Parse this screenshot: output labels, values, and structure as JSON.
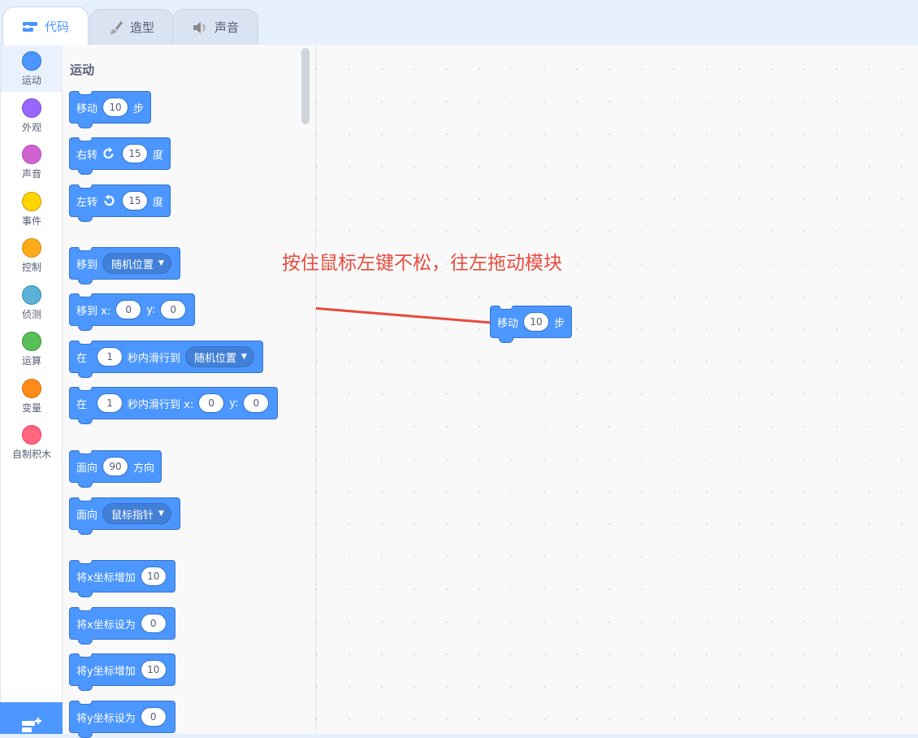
{
  "tabs": [
    {
      "label": "代码",
      "icon": "code-icon"
    },
    {
      "label": "造型",
      "icon": "paintbrush-icon"
    },
    {
      "label": "声音",
      "icon": "speaker-icon"
    }
  ],
  "categories": [
    {
      "label": "运动",
      "color": "#4c97ff"
    },
    {
      "label": "外观",
      "color": "#9966ff"
    },
    {
      "label": "声音",
      "color": "#cf63cf"
    },
    {
      "label": "事件",
      "color": "#ffd500"
    },
    {
      "label": "控制",
      "color": "#ffab19"
    },
    {
      "label": "侦测",
      "color": "#5cb1d6"
    },
    {
      "label": "运算",
      "color": "#59c059"
    },
    {
      "label": "变量",
      "color": "#ff8c1a"
    },
    {
      "label": "自制积木",
      "color": "#ff6680"
    }
  ],
  "palette": {
    "title": "运动",
    "move": {
      "a": "移动",
      "v": "10",
      "b": "步"
    },
    "turn_right": {
      "a": "右转",
      "v": "15",
      "b": "度"
    },
    "turn_left": {
      "a": "左转",
      "v": "15",
      "b": "度"
    },
    "goto": {
      "a": "移到",
      "menu": "随机位置"
    },
    "goto_xy": {
      "a": "移到 x:",
      "x": "0",
      "b": "y:",
      "y": "0"
    },
    "glide": {
      "a": "在",
      "v": "1",
      "b": "秒内滑行到",
      "menu": "随机位置"
    },
    "glide_xy": {
      "a": "在",
      "v": "1",
      "b": "秒内滑行到 x:",
      "x": "0",
      "c": "y:",
      "y": "0"
    },
    "point_dir": {
      "a": "面向",
      "v": "90",
      "b": "方向"
    },
    "point_towards": {
      "a": "面向",
      "menu": "鼠标指针"
    },
    "change_x": {
      "a": "将x坐标增加",
      "v": "10"
    },
    "set_x": {
      "a": "将x坐标设为",
      "v": "0"
    },
    "change_y": {
      "a": "将y坐标增加",
      "v": "10"
    },
    "set_y": {
      "a": "将y坐标设为",
      "v": "0"
    }
  },
  "workspace": {
    "annotation": "按住鼠标左键不松，往左拖动模块",
    "block": {
      "a": "移动",
      "v": "10",
      "b": "步"
    }
  },
  "colors": {
    "motion": "#4c97ff",
    "annotation": "#e84c3d"
  }
}
